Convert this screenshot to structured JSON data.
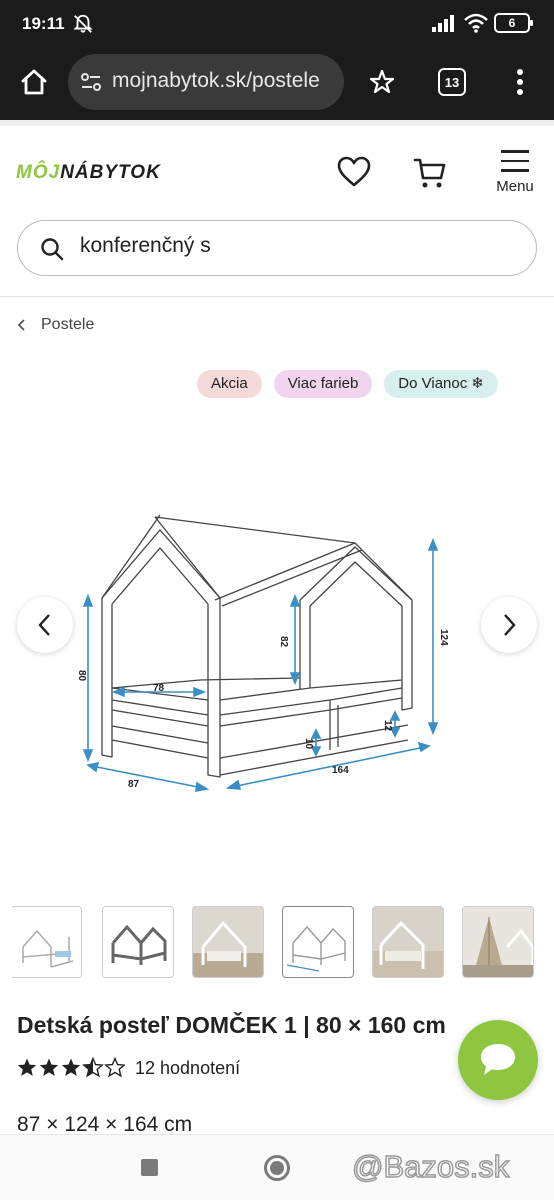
{
  "status_bar": {
    "time": "19:11",
    "battery": "6"
  },
  "browser": {
    "url": "mojnabytok.sk/postele",
    "tab_count": "13"
  },
  "header": {
    "logo_part1": "MÔJ",
    "logo_part2": "NÁBYTOK",
    "menu_label": "Menu"
  },
  "search": {
    "value": "konferenčný s"
  },
  "breadcrumb": {
    "label": "Postele"
  },
  "badges": [
    {
      "label": "Akcia",
      "color": "#f6d9d9"
    },
    {
      "label": "Viac farieb",
      "color": "#f3d4ee"
    },
    {
      "label": "Do Vianoc ❄",
      "color": "#d7f0ef"
    }
  ],
  "drawing_dims": {
    "height_left": "80",
    "width_front": "87",
    "length": "164",
    "total_height": "124",
    "inner_height": "82",
    "inner_width": "78",
    "leg": "10",
    "drawer": "12"
  },
  "product": {
    "title": "Detská posteľ DOMČEK 1 | 80 × 160 cm",
    "rating": 3.5,
    "reviews": "12 hodnotení",
    "dimensions": "87 × 124 × 164 cm"
  },
  "watermark": "@Bazos.sk",
  "colors": {
    "brand_green": "#8ec63f",
    "dim_line": "#3a8fc4"
  },
  "icons": [
    "home-icon",
    "site-info-icon",
    "star-icon",
    "tabs-icon",
    "more-icon",
    "heart-icon",
    "cart-icon",
    "menu-icon",
    "search-icon",
    "chevron-left-icon",
    "chevron-right-icon",
    "chat-icon"
  ]
}
